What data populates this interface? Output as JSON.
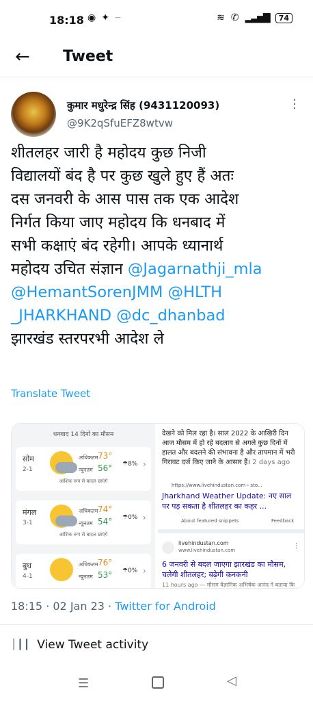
{
  "status_bar": {
    "time": "18:18",
    "left_icons": [
      "location-pin-icon",
      "twitter-bird-icon",
      "dash-icon"
    ],
    "right_icons": [
      "wifi-icon",
      "wifi-call-icon",
      "signal-icon"
    ],
    "battery": "74"
  },
  "header": {
    "back_icon": "arrow-left-icon",
    "title": "Tweet"
  },
  "tweet": {
    "author_name": "कुमार मधुरेन्द्र सिंह (9431120093)",
    "author_handle": "@9K2qSfuEFZ8wtvw",
    "text_part1": "शीतलहर जारी है महोदय कुछ निजी\nविद्यालयों बंद है पर कुछ खुले हुए हैं अतः\nदस जनवरी के आस पास तक एक आदेश\nनिर्गत किया जाए महोदय कि धनबाद में\nसभी कक्षाएं बंद रहेगी। आपके ध्यानार्थ\nमहोदय उचित संज्ञान  ",
    "mention1": "@Jagarnathji_mla",
    "mention2": "@HemantSorenJMM",
    "mention3": "@HLTH\n_JHARKHAND",
    "mention4": "@dc_dhanbad",
    "text_part2": "झारखंड स्तरपरभी आदेश ले",
    "translate_label": "Translate Tweet",
    "time": "18:15 · 02 Jan 23 · ",
    "source": "Twitter for Android",
    "activity_label": "View Tweet activity"
  },
  "media": {
    "weather": {
      "title": "धनबाद 14 दिनों का मौसम",
      "days": [
        {
          "day": "सोम",
          "date": "2-1",
          "max_label": "अधिकतम",
          "max": "73°",
          "min_label": "न्यूनतम",
          "min": "56°",
          "rain": "8%",
          "desc": "आंशिक रूप से बादल छाएंगे"
        },
        {
          "day": "मंगल",
          "date": "3-1",
          "max_label": "अधिकतम",
          "max": "74°",
          "min_label": "न्यूनतम",
          "min": "54°",
          "rain": "0%",
          "desc": "आंशिक रूप से बादल छाएंगे"
        },
        {
          "day": "बुध",
          "date": "4-1",
          "max_label": "अधिकतम",
          "max": "76°",
          "min_label": "न्यूनतम",
          "min": "53°",
          "rain": "0%",
          "desc": ""
        }
      ]
    },
    "news": {
      "snippet": "देखने को मिल रहा है। साल 2022 के आखिरी दिन आज मौसम में हो रहे बदलाव से अगले कुछ दिनों में हालत और बदलने की संभावना है और तापमान में भरी गिरावट दर्ज किए जाने के आसार हैं।",
      "snippet_time": "2 days ago",
      "url1": "https://www.livehindustan.com › sto...",
      "link1": "Jharkhand Weather Update: नए साल पर पड़ सकता है शीतलहर का कहर ...",
      "featured": "About featured snippets",
      "feedback": "Feedback",
      "site2": "livehindustan.com",
      "url2": "www.livehindustan.com",
      "link2": "6 जनवरी से बदल जाएगा झारखंड का मौसम, चलेगी शीतलहर; बढ़ेगी कनकनी",
      "time2": "11 hours ago — मौसम वैज्ञानिक अभिषेक आनंद ने बताया कि"
    }
  },
  "colors": {
    "accent": "#1d9bf0",
    "text": "#0f1419",
    "muted": "#536471"
  }
}
